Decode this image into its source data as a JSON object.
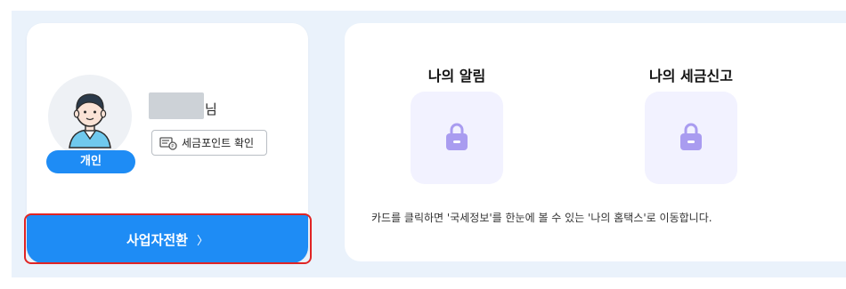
{
  "profile": {
    "name_suffix": "님",
    "badge": "개인",
    "points_button": "세금포인트 확인",
    "switch_business_button": "사업자전환",
    "switch_arrow": "〉"
  },
  "services": {
    "items": [
      {
        "title": "나의 알림",
        "icon": "lock-icon"
      },
      {
        "title": "나의 세금신고",
        "icon": "lock-icon"
      }
    ],
    "helper_text": "카드를 클릭하면 '국세정보'를 한눈에 볼 수 있는 '나의 홈택스'로 이동합니다."
  },
  "colors": {
    "accent": "#1e8cf5",
    "tile_bg": "#f2f2ff",
    "lock_icon": "#a99cf0",
    "highlight": "#e02424",
    "page_bg": "#eaf2fb"
  }
}
